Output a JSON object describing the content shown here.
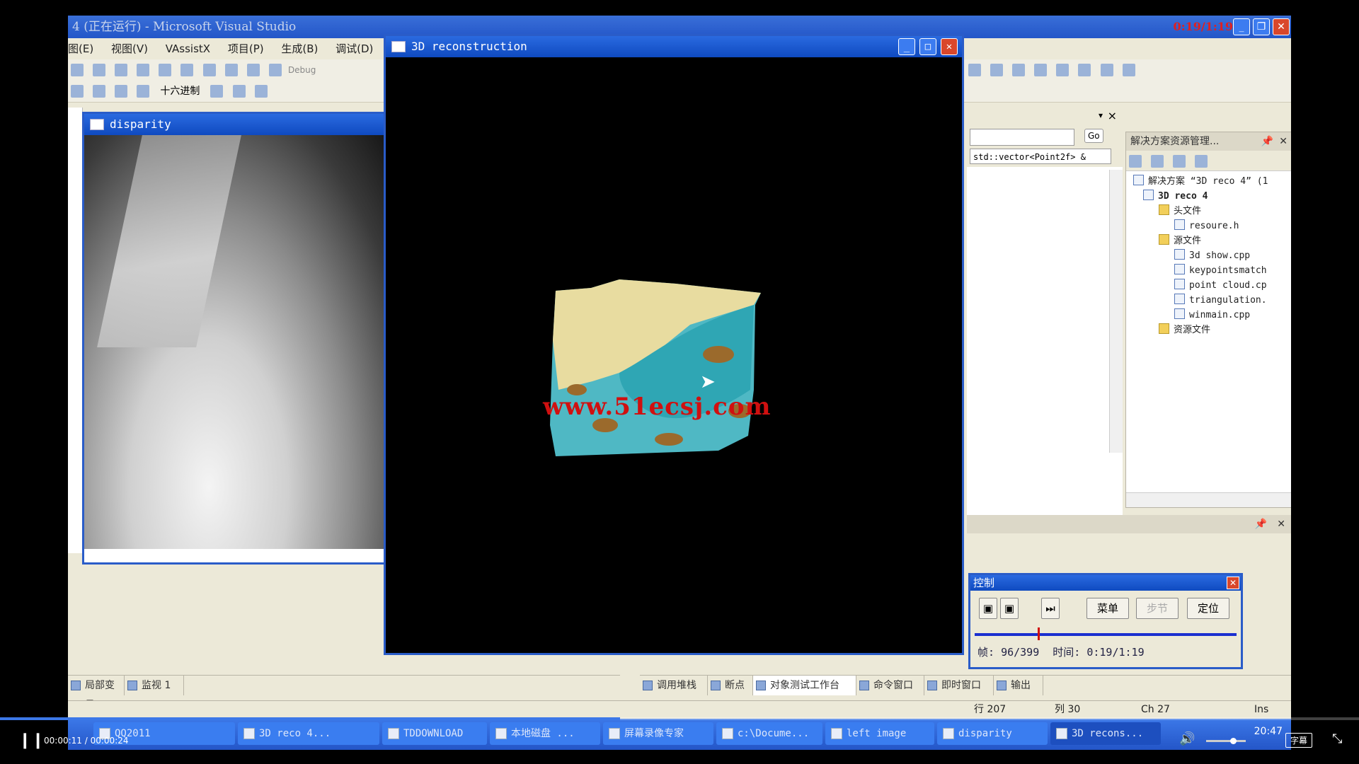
{
  "player": {
    "title": "019_OpenGL三维重建.avi",
    "time_current": "00:00:11",
    "time_separator": "/",
    "time_total": "00:00:24",
    "subtitle_label": "字幕",
    "progress_fraction": 0.456,
    "overlay_time": "0:19/1:19"
  },
  "vs": {
    "title": "4 (正在运行) - Microsoft Visual Studio",
    "menu": [
      "图(E)",
      "视图(V)",
      "VAssistX",
      "项目(P)",
      "生成(B)",
      "调试(D)"
    ],
    "debug_label": "Debug",
    "hex_label": "十六进制",
    "go_label": "Go",
    "code_combo_value": "std::vector<Point2f> &"
  },
  "disparity_window": {
    "title": "disparity"
  },
  "reconstruction_window": {
    "title": "3D reconstruction",
    "watermark": "www.51ecsj.com"
  },
  "solution_explorer": {
    "title": "解决方案资源管理...",
    "items": [
      {
        "label": "解决方案 “3D reco 4” (1",
        "level": 0,
        "icon": "solution-icon"
      },
      {
        "label": "3D reco 4",
        "level": 1,
        "icon": "project-icon"
      },
      {
        "label": "头文件",
        "level": 2,
        "icon": "folder-icon"
      },
      {
        "label": "resoure.h",
        "level": 3,
        "icon": "header-file-icon"
      },
      {
        "label": "源文件",
        "level": 2,
        "icon": "folder-icon"
      },
      {
        "label": "3d show.cpp",
        "level": 3,
        "icon": "cpp-file-icon"
      },
      {
        "label": "keypointsmatch",
        "level": 3,
        "icon": "cpp-file-icon"
      },
      {
        "label": "point cloud.cp",
        "level": 3,
        "icon": "cpp-file-icon"
      },
      {
        "label": "triangulation.",
        "level": 3,
        "icon": "cpp-file-icon"
      },
      {
        "label": "winmain.cpp",
        "level": 3,
        "icon": "cpp-file-icon"
      },
      {
        "label": "资源文件",
        "level": 2,
        "icon": "folder-icon"
      }
    ]
  },
  "control_panel": {
    "title": "控制",
    "menu_button": "菜单",
    "step_button": "步节",
    "locate_button": "定位",
    "frame_label": "帧:",
    "frame_value": "96/399",
    "time_label": "时间:",
    "time_value": "0:19/1:19",
    "slider_fraction": 0.24
  },
  "bottom_left_tabs": [
    "局部变量",
    "监视 1"
  ],
  "bottom_right_tabs": [
    "调用堆栈",
    "断点",
    "对象测试工作台",
    "命令窗口",
    "即时窗口",
    "输出"
  ],
  "status": {
    "line": "行 207",
    "col": "列 30",
    "ch": "Ch 27",
    "mode": "Ins"
  },
  "taskbar": {
    "items": [
      "QQ2011",
      "3D reco 4...",
      "TDDOWNLOAD",
      "本地磁盘 ...",
      "屏幕录像专家",
      "c:\\Docume...",
      "left image",
      "disparity",
      "3D recons..."
    ],
    "clock": "20:47"
  },
  "colors": {
    "accent": "#2a5cc8",
    "progress": "#3c78e8",
    "watermark": "#d01010"
  }
}
